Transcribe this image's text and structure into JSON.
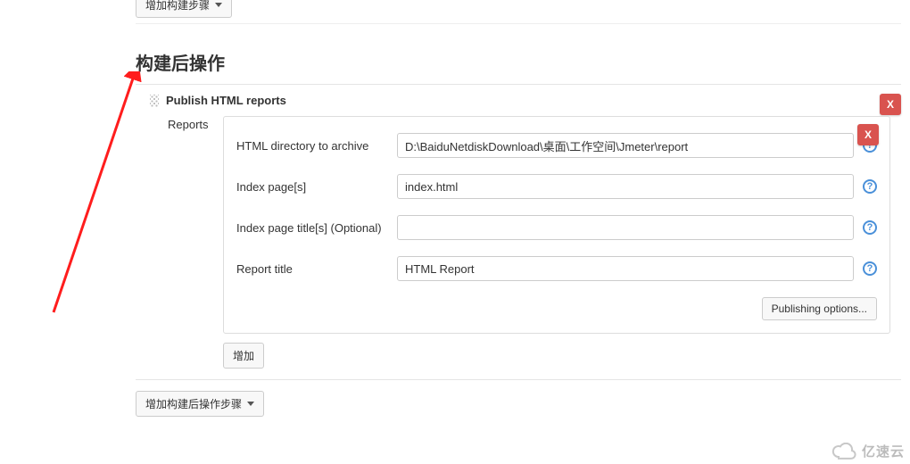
{
  "topDropdown": {
    "label": "增加构建步骤"
  },
  "section": {
    "title": "构建后操作"
  },
  "panel": {
    "title": "Publish HTML reports",
    "closeLabel": "X",
    "sideLabel": "Reports",
    "innerCloseLabel": "X",
    "fields": {
      "dir": {
        "label": "HTML directory to archive",
        "value": "D:\\BaiduNetdiskDownload\\桌面\\工作空间\\Jmeter\\report"
      },
      "index": {
        "label": "Index page[s]",
        "value": "index.html"
      },
      "titleOpt": {
        "label": "Index page title[s] (Optional)",
        "value": ""
      },
      "reportTitle": {
        "label": "Report title",
        "value": "HTML Report"
      }
    },
    "publishingOptions": "Publishing options...",
    "addButton": "增加"
  },
  "bottomDropdown": {
    "label": "增加构建后操作步骤"
  },
  "helpGlyph": "?",
  "watermark": {
    "text": "亿速云"
  },
  "annotation": {
    "arrowColor": "#ff1d1d"
  }
}
